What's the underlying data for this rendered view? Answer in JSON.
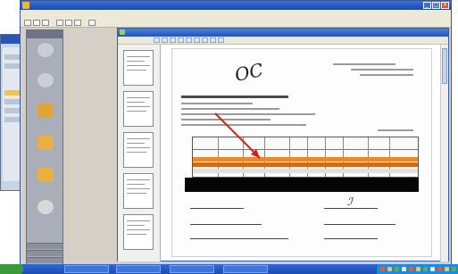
{
  "app": {
    "title": "",
    "menu": [
      "",
      "",
      "",
      "",
      "",
      "",
      ""
    ]
  },
  "viewer": {
    "title": ""
  },
  "left_nav": {
    "header": "",
    "items": [
      {
        "label": "",
        "icon": "globe-icon",
        "color": "#c9ced8"
      },
      {
        "label": "",
        "icon": "globe-icon",
        "color": "#c9ced8"
      },
      {
        "label": "",
        "icon": "box-icon",
        "color": "#e2a437"
      },
      {
        "label": "",
        "icon": "folder-icon",
        "color": "#e8b040"
      },
      {
        "label": "",
        "icon": "folder-icon",
        "color": "#e8b040"
      },
      {
        "label": "",
        "icon": "help-icon",
        "color": "#d8d8d8"
      }
    ]
  },
  "document": {
    "handwriting_line1": "",
    "handwriting_line2": "ОС",
    "annotation_color": "#d61a1a",
    "highlight_color": "#e8892a"
  },
  "taskbar": {
    "start_label": "",
    "tasks": [
      "",
      "",
      "",
      ""
    ]
  },
  "colors": {
    "title_blue": "#1c48a6",
    "taskbar_blue": "#2f68d6"
  }
}
